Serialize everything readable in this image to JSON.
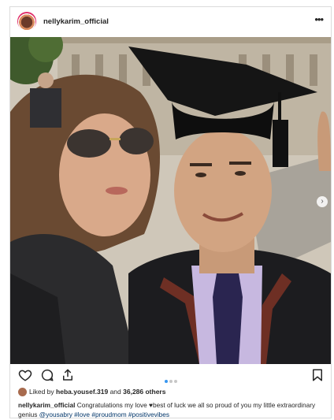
{
  "post": {
    "username": "nellykarim_official",
    "more_icon": "more-horizontal-icon",
    "image_alt": "Selfie of a woman in sunglasses with a graduate in cap and gown",
    "carousel": {
      "count": 3,
      "active": 0
    },
    "likes": {
      "prefix": "Liked by",
      "first_user": "heba.yousef.319",
      "middle": "and",
      "count_text": "36,286 others"
    },
    "caption": {
      "author": "nellykarim_official",
      "text_part1": "Congratulations my love ",
      "heart": "♥",
      "text_part2": "best of luck we all so proud of you my little extraordinary genius ",
      "mention": "@yousabry",
      "hashtags": [
        "#love",
        "#proudmom",
        "#positivevibes"
      ]
    }
  },
  "icons": [
    "heart-icon",
    "comment-icon",
    "share-icon",
    "bookmark-icon",
    "carousel-next-icon"
  ],
  "colors": {
    "link": "#003569",
    "accent": "#3897f0",
    "border": "#dbdbdb"
  }
}
